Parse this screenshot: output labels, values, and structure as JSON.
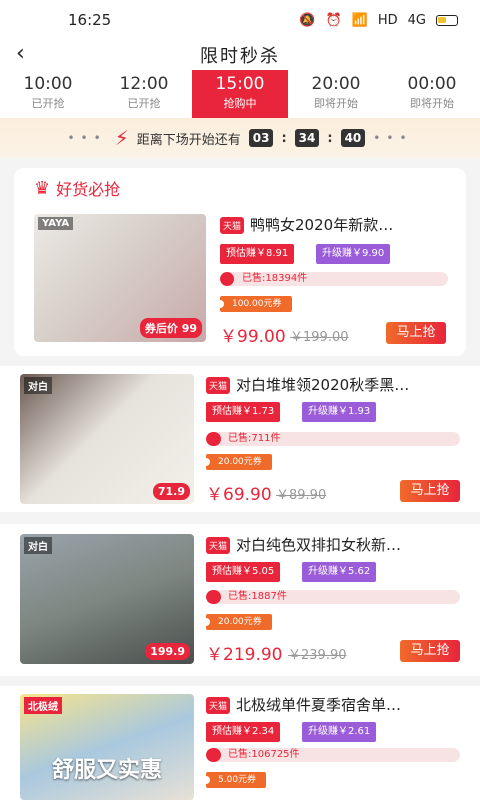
{
  "status_bar": {
    "time": "16:25",
    "network": "HD",
    "signal": "4G"
  },
  "nav": {
    "title": "限时秒杀"
  },
  "tabs": [
    {
      "time": "10:00",
      "status": "已开抢"
    },
    {
      "time": "12:00",
      "status": "已开抢"
    },
    {
      "time": "15:00",
      "status": "抢购中"
    },
    {
      "time": "20:00",
      "status": "即将开始"
    },
    {
      "time": "00:00",
      "status": "即将开始"
    }
  ],
  "countdown": {
    "label": "距离下场开始还有",
    "hours": "03",
    "minutes": "34",
    "seconds": "40"
  },
  "featured": {
    "heading": "好货必抢"
  },
  "products": [
    {
      "title": "鸭鸭女2020年新款…",
      "shop_badge": "天猫",
      "image_brand": "YAYA",
      "image_badge": "券后价 99",
      "estimate": "预估赚￥8.91",
      "upgrade": "升级赚￥9.90",
      "sold": "已售:18394件",
      "sold_fraction": 0.06,
      "coupon": "100.00元券",
      "price": "￥99.00",
      "old_price": "￥199.00",
      "buy": "马上抢"
    },
    {
      "title": "对白堆堆领2020秋季黑…",
      "shop_badge": "天猫",
      "image_brand": "对白",
      "image_badge": "71.9",
      "estimate": "预估赚￥1.73",
      "upgrade": "升级赚￥1.93",
      "sold": "已售:711件",
      "sold_fraction": 0.06,
      "coupon": "20.00元券",
      "price": "￥69.90",
      "old_price": "￥89.90",
      "buy": "马上抢"
    },
    {
      "title": "对白纯色双排扣女秋新…",
      "shop_badge": "天猫",
      "image_brand": "对白",
      "image_badge": "199.9",
      "estimate": "预估赚￥5.05",
      "upgrade": "升级赚￥5.62",
      "sold": "已售:1887件",
      "sold_fraction": 0.06,
      "coupon": "20.00元券",
      "price": "￥219.90",
      "old_price": "￥239.90",
      "buy": "马上抢"
    },
    {
      "title": "北极绒单件夏季宿舍单…",
      "shop_badge": "天猫",
      "image_brand": "北极绒",
      "image_caption": "舒服又实惠",
      "estimate": "预估赚￥2.34",
      "upgrade": "升级赚￥2.61",
      "sold": "已售:106725件",
      "sold_fraction": 0.06,
      "coupon": "5.00元券"
    }
  ],
  "colors": {
    "accent": "#e8253a",
    "upgrade": "#9a5cd8",
    "coupon": "#f06a2a"
  }
}
